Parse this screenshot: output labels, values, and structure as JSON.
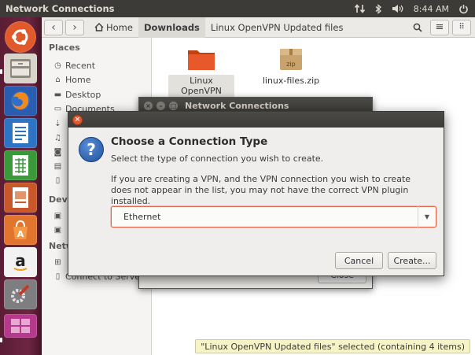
{
  "top_panel": {
    "title": "Network Connections",
    "time": "8:44 AM",
    "icons": [
      "network-arrows-icon",
      "bluetooth-icon",
      "volume-icon",
      "power-icon"
    ]
  },
  "launcher": {
    "items": [
      "ubuntu-dash-icon",
      "files-icon",
      "firefox-icon",
      "writer-icon",
      "calc-icon",
      "impress-icon",
      "software-center-icon",
      "amazon-icon",
      "system-settings-icon",
      "workspace-switcher-icon"
    ]
  },
  "file_manager": {
    "breadcrumbs": [
      "Home",
      "Downloads",
      "Linux OpenVPN Updated files"
    ],
    "sidebar": {
      "places_header": "Places",
      "places": [
        "Recent",
        "Home",
        "Desktop",
        "Documents"
      ],
      "devices_header": "Devi",
      "network_header": "Netw",
      "connect_to_server": "Connect to Server"
    },
    "files": [
      {
        "label": "Linux OpenVPN Updated files",
        "type": "folder"
      },
      {
        "label": "linux-files.zip",
        "type": "zip"
      }
    ],
    "zip_badge": "zip",
    "status": "\"Linux OpenVPN Updated files\" selected  (containing 4 items)"
  },
  "nc_window": {
    "title": "Network Connections",
    "close_label": "Close"
  },
  "dialog": {
    "heading": "Choose a Connection Type",
    "subtitle": "Select the type of connection you wish to create.",
    "info": "If you are creating a VPN, and the VPN connection you wish to create does not appear in the list, you may not have the correct VPN plugin installed.",
    "connection_type": "Ethernet",
    "cancel_label": "Cancel",
    "create_label": "Create..."
  },
  "colors": {
    "panel": "#3c3b37",
    "launcher": "#6d2642",
    "accent": "#e1684a",
    "folder": "#e9582a"
  }
}
